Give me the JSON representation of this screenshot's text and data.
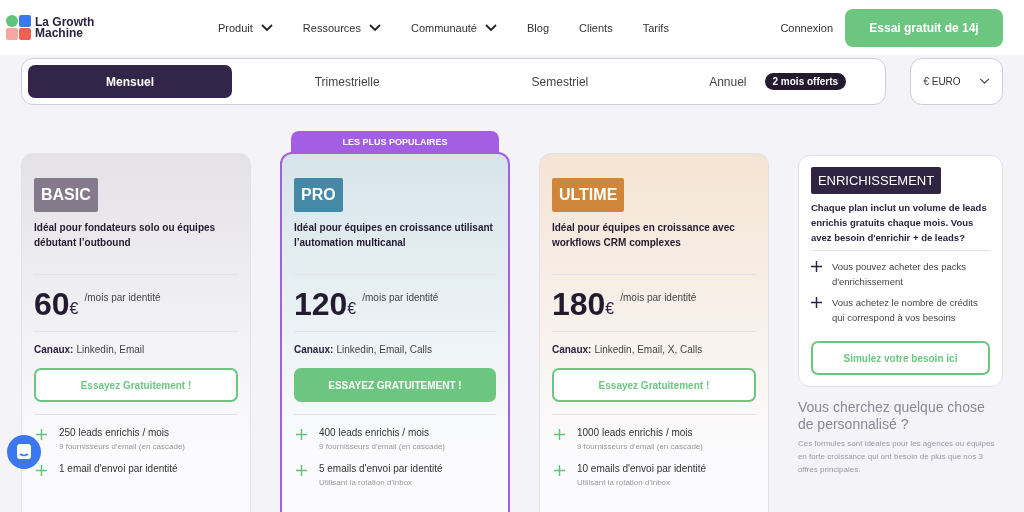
{
  "header": {
    "logo": "La Growth Machine",
    "nav": [
      {
        "label": "Produit",
        "dropdown": true
      },
      {
        "label": "Ressources",
        "dropdown": true
      },
      {
        "label": "Communauté",
        "dropdown": true
      },
      {
        "label": "Blog",
        "dropdown": false
      },
      {
        "label": "Clients",
        "dropdown": false
      },
      {
        "label": "Tarifs",
        "dropdown": false
      }
    ],
    "login": "Connexion",
    "cta": "Essai gratuit de 14j"
  },
  "billing": {
    "options": [
      {
        "label": "Mensuel",
        "selected": true
      },
      {
        "label": "Trimestrielle",
        "selected": false
      },
      {
        "label": "Semestriel",
        "selected": false
      },
      {
        "label": "Annuel",
        "selected": false,
        "badge": "2 mois offerts"
      }
    ],
    "currency": "€ EURO"
  },
  "plans": [
    {
      "name": "BASIC",
      "color": "#847a8c",
      "popular": false,
      "description": "Idéal pour fondateurs solo ou équipes débutant l’outbound",
      "price": "60",
      "currency": "€",
      "period": "/mois par identité",
      "channels_label": "Canaux:",
      "channels": "Linkedin, Email",
      "cta": {
        "label": "Essayez Gratuitement !",
        "kind": "outline"
      },
      "features": [
        {
          "text": "250 leads enrichis / mois",
          "sub": "9 fournisseurs d'email (en cascade)"
        },
        {
          "text": "1 email d'envoi par identité"
        }
      ]
    },
    {
      "name": "PRO",
      "color": "#448aa6",
      "popular": true,
      "badge": "LES PLUS POPULAIRES",
      "description": "Idéal pour équipes en croissance utilisant l’automation multicanal",
      "price": "120",
      "currency": "€",
      "period": "/mois par identité",
      "channels_label": "Canaux:",
      "channels": "Linkedin, Email, Calls",
      "cta": {
        "label": "ESSAYEZ GRATUITEMENT !",
        "kind": "filled"
      },
      "features": [
        {
          "text": "400 leads enrichis / mois",
          "sub": "9 fournisseurs d'email (en cascade)"
        },
        {
          "text": "5 emails d'envoi par identité",
          "sub": "Utilisant la rotation d'inbox"
        }
      ]
    },
    {
      "name": "ULTIME",
      "color": "#cf8638",
      "popular": false,
      "description": "Idéal pour équipes en croissance avec workflows CRM complexes",
      "price": "180",
      "currency": "€",
      "period": "/mois par identité",
      "channels_label": "Canaux:",
      "channels": "Linkedin, Email, X, Calls",
      "cta": {
        "label": "Essayez Gratuitement !",
        "kind": "outline"
      },
      "features": [
        {
          "text": "1000 leads enrichis / mois",
          "sub": "9 fournisseurs d'email (en cascade)"
        },
        {
          "text": "10 emails d'envoi par identité",
          "sub": "Utilisant la rotation d'inbox"
        }
      ]
    }
  ],
  "enrichment": {
    "title": "ENRICHISSEMENT",
    "description": "Chaque plan inclut un volume de leads enrichis gratuits chaque mois. Vous avez besoin d'enrichir + de leads?",
    "items": [
      "Vous pouvez acheter des packs d'enrichissement",
      "Vous achetez le nombre de crédits qui correspond à vos besoins"
    ],
    "cta": "Simulez votre besoin ici"
  },
  "custom": {
    "title": "Vous cherchez quelque chose de personnalisé ?",
    "text": "Ces formules sont idéales pour les agences ou équipes en forte croissance qui ont besoin de plus que nos 3 offres principales."
  }
}
